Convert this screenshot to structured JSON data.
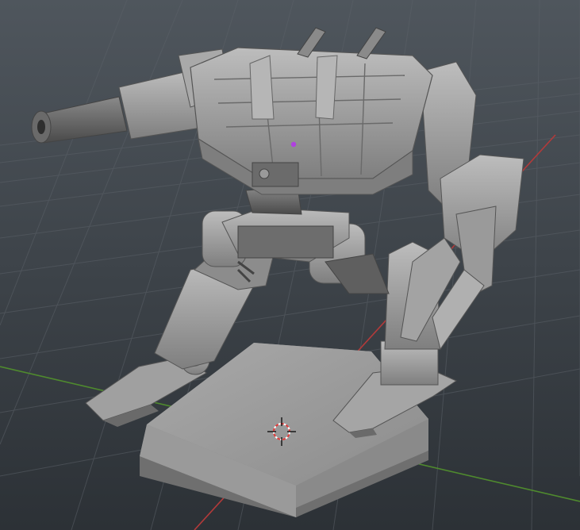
{
  "viewport": {
    "background_top": "#4e555c",
    "background_bottom": "#2b3035",
    "grid_color": "#5a6068",
    "x_axis_color": "#b33a3a",
    "y_axis_color": "#4f8a2e",
    "model_color": "#9c9c9c",
    "model_shadow": "#5c5c5c",
    "model_highlight": "#c4c4c4",
    "selected_vertex_color": "#b040e0",
    "cursor_icon": "3d-cursor-icon"
  }
}
